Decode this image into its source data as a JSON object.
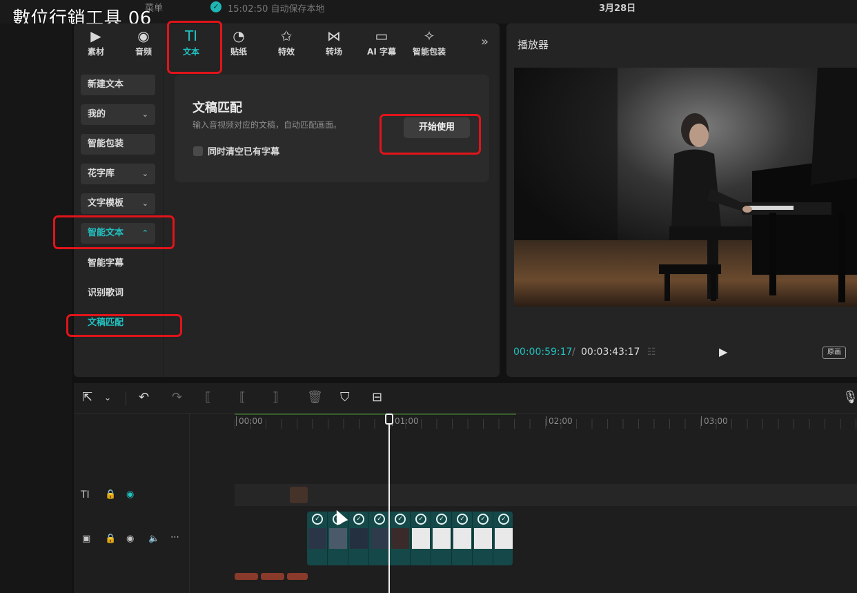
{
  "overlay_title": "數位行銷工具 06",
  "topbar": {
    "menu_label": "菜单",
    "save_status": "15:02:50 自动保存本地",
    "date": "3月28日"
  },
  "tool_tabs": [
    {
      "label": "素材",
      "icon": "media-icon",
      "glyph": "▶"
    },
    {
      "label": "音频",
      "icon": "audio-icon",
      "glyph": "◉"
    },
    {
      "label": "文本",
      "icon": "text-icon",
      "glyph": "TI"
    },
    {
      "label": "贴纸",
      "icon": "sticker-icon",
      "glyph": "◔"
    },
    {
      "label": "特效",
      "icon": "effect-icon",
      "glyph": "✩"
    },
    {
      "label": "转场",
      "icon": "transition-icon",
      "glyph": "⋈"
    },
    {
      "label": "AI 字幕",
      "icon": "ai-subtitle-icon",
      "glyph": "▭"
    },
    {
      "label": "智能包装",
      "icon": "smart-pack-icon",
      "glyph": "✧"
    }
  ],
  "tab_more": "»",
  "side_menu": [
    {
      "label": "新建文本",
      "chevron": ""
    },
    {
      "label": "我的",
      "chevron": "⌄"
    },
    {
      "label": "智能包装",
      "chevron": ""
    },
    {
      "label": "花字库",
      "chevron": "⌄"
    },
    {
      "label": "文字模板",
      "chevron": "⌄"
    },
    {
      "label": "智能文本",
      "chevron": "⌃"
    },
    {
      "label": "智能字幕",
      "chevron": ""
    },
    {
      "label": "识别歌词",
      "chevron": ""
    },
    {
      "label": "文稿匹配",
      "chevron": ""
    }
  ],
  "match_card": {
    "title": "文稿匹配",
    "description": "输入音视频对应的文稿，自动匹配画面。",
    "clear_label": "同时清空已有字幕",
    "start_button": "开始使用"
  },
  "player": {
    "title": "播放器",
    "time_current": "00:00:59:17",
    "time_separator": "/",
    "time_total": "00:03:43:17",
    "ratio_button": "原画"
  },
  "timeline": {
    "ruler_labels": [
      "00:00",
      "01:00",
      "02:00",
      "03:00"
    ],
    "clip_count": 10
  },
  "colors": {
    "accent": "#21c2c2",
    "annotation": "#e2141a",
    "panel": "#242424"
  }
}
